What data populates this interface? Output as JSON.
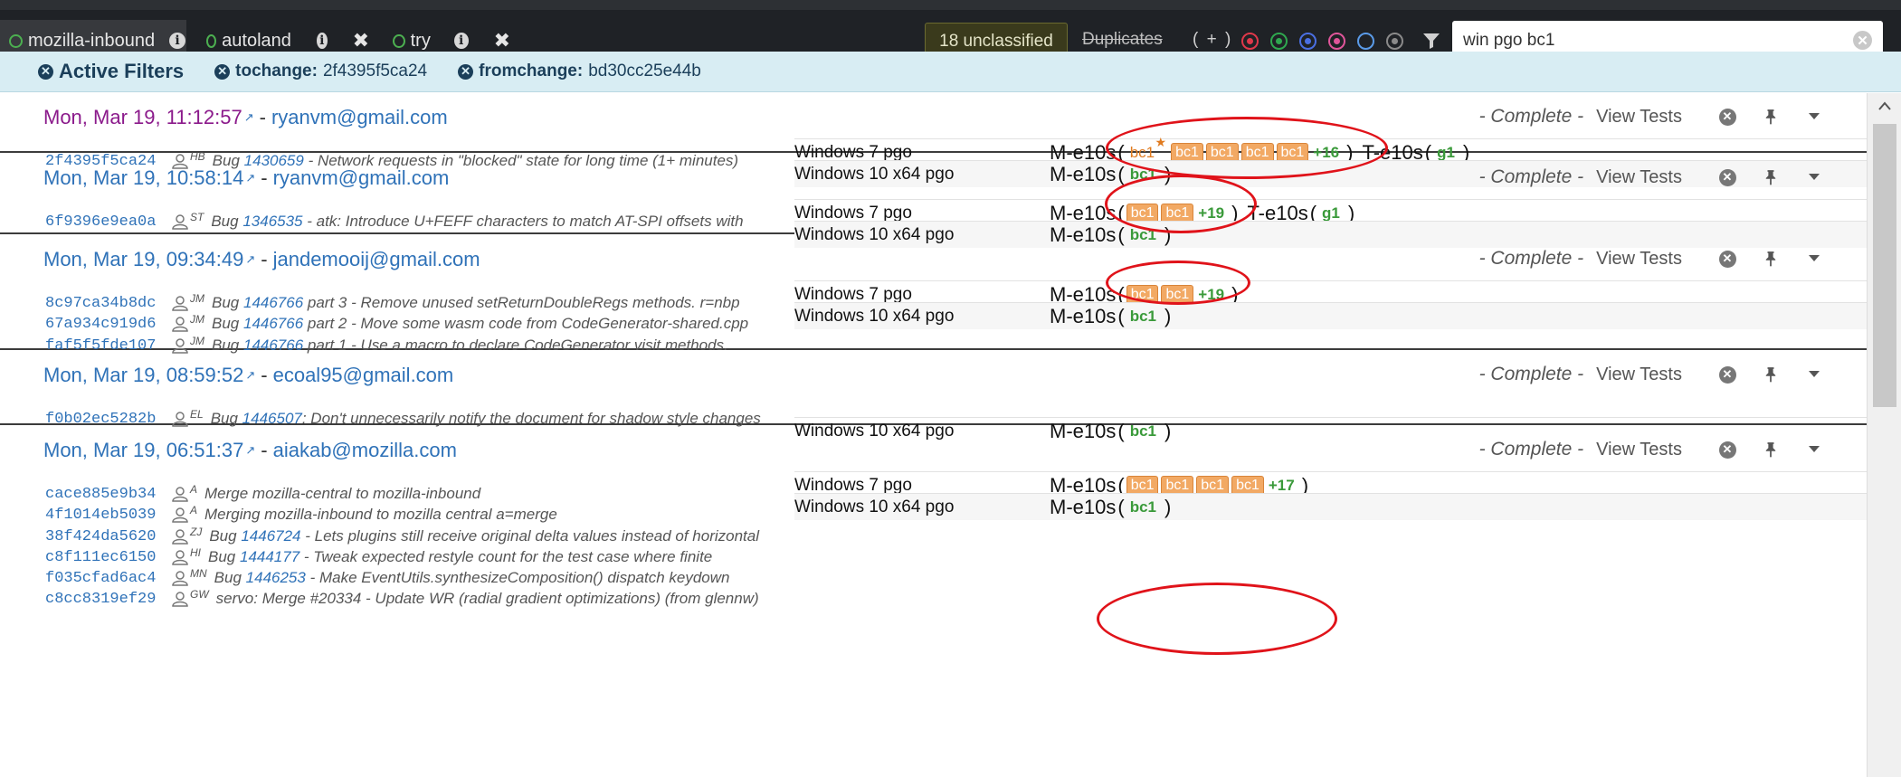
{
  "nav": {
    "repos": [
      {
        "name": "mozilla-inbound",
        "active": true
      },
      {
        "name": "autoland",
        "active": false
      },
      {
        "name": "try",
        "active": false
      }
    ],
    "unclassified_label": "18 unclassified",
    "duplicates_label": "Duplicates",
    "plus_label": "( + )",
    "status_colors": [
      "#e0384a",
      "#2fa84f",
      "#4a6fe3",
      "#e0559a",
      "#5a9be8",
      "#8a8a8a"
    ],
    "search": {
      "value": "win pgo bc1",
      "placeholder": ""
    }
  },
  "filters": {
    "title": "Active Filters",
    "chips": [
      {
        "key": "tochange:",
        "value": "2f4395f5ca24"
      },
      {
        "key": "fromchange:",
        "value": "bd30cc25e44b"
      }
    ]
  },
  "push_labels": {
    "complete": "- Complete -",
    "view_tests": "View Tests"
  },
  "pushes": [
    {
      "date": "Mon, Mar 19, 11:12:57",
      "author": "ryanvm@gmail.com",
      "unread": true,
      "revisions": [
        {
          "hash": "2f4395f5ca24",
          "initials": "HB",
          "bug_prefix": "Bug ",
          "bug": "1430659",
          "desc": " - Network requests in \"blocked\" state for long time (1+ minutes)"
        }
      ],
      "platforms": [
        {
          "name": "Windows 7 pgo",
          "group1": "M-e10s",
          "jobs": [
            "bc1",
            "bc1",
            "bc1",
            "bc1",
            "bc1"
          ],
          "first_starred": true,
          "more": "+16",
          "group2": "T-e10s",
          "group2_job": "g1"
        },
        {
          "name": "Windows 10 x64 pgo",
          "group1": "M-e10s",
          "green_job": "bc1"
        }
      ]
    },
    {
      "date": "Mon, Mar 19, 10:58:14",
      "author": "ryanvm@gmail.com",
      "unread": false,
      "revisions": [
        {
          "hash": "6f9396e9ea0a",
          "initials": "ST",
          "bug_prefix": "Bug ",
          "bug": "1346535",
          "desc": " - atk: Introduce U+FEFF characters to match AT-SPI offsets with"
        }
      ],
      "platforms": [
        {
          "name": "Windows 7 pgo",
          "group1": "M-e10s",
          "jobs": [
            "bc1",
            "bc1"
          ],
          "more": "+19",
          "group2": "T-e10s",
          "group2_job": "g1"
        },
        {
          "name": "Windows 10 x64 pgo",
          "group1": "M-e10s",
          "green_job": "bc1"
        }
      ]
    },
    {
      "date": "Mon, Mar 19, 09:34:49",
      "author": "jandemooij@gmail.com",
      "unread": false,
      "revisions": [
        {
          "hash": "8c97ca34b8dc",
          "initials": "JM",
          "bug_prefix": "Bug ",
          "bug": "1446766",
          "desc": " part 3 - Remove unused setReturnDoubleRegs methods. r=nbp"
        },
        {
          "hash": "67a934c919d6",
          "initials": "JM",
          "bug_prefix": "Bug ",
          "bug": "1446766",
          "desc": " part 2 - Move some wasm code from CodeGenerator-shared.cpp"
        },
        {
          "hash": "faf5f5fde107",
          "initials": "JM",
          "bug_prefix": "Bug ",
          "bug": "1446766",
          "desc": " part 1 - Use a macro to declare CodeGenerator visit methods."
        }
      ],
      "platforms": [
        {
          "name": "Windows 7 pgo",
          "group1": "M-e10s",
          "jobs": [
            "bc1",
            "bc1"
          ],
          "more": "+19"
        },
        {
          "name": "Windows 10 x64 pgo",
          "group1": "M-e10s",
          "green_job": "bc1"
        }
      ]
    },
    {
      "date": "Mon, Mar 19, 08:59:52",
      "author": "ecoal95@gmail.com",
      "unread": false,
      "revisions": [
        {
          "hash": "f0b02ec5282b",
          "initials": "EL",
          "bug_prefix": "Bug ",
          "bug": "1446507",
          "desc": ": Don't unnecessarily notify the document for shadow style changes"
        }
      ],
      "platforms": [
        {
          "name": "Windows 10 x64 pgo",
          "group1": "M-e10s",
          "green_job": "bc1"
        }
      ]
    },
    {
      "date": "Mon, Mar 19, 06:51:37",
      "author": "aiakab@mozilla.com",
      "unread": false,
      "revisions": [
        {
          "hash": "cace885e9b34",
          "initials": "A",
          "bug_prefix": "",
          "bug": "",
          "desc": "Merge mozilla-central to mozilla-inbound"
        },
        {
          "hash": "4f1014eb5039",
          "initials": "A",
          "bug_prefix": "",
          "bug": "",
          "desc": "Merging mozilla-inbound to mozilla central a=merge"
        },
        {
          "hash": "38f424da5620",
          "initials": "ZJ",
          "bug_prefix": "Bug ",
          "bug": "1446724",
          "desc": " - Lets plugins still receive original delta values instead of horizontal"
        },
        {
          "hash": "c8f111ec6150",
          "initials": "HI",
          "bug_prefix": "Bug ",
          "bug": "1444177",
          "desc": " - Tweak expected restyle count for the test case where finite"
        },
        {
          "hash": "f035cfad6ac4",
          "initials": "MN",
          "bug_prefix": "Bug ",
          "bug": "1446253",
          "desc": " - Make EventUtils.synthesizeComposition() dispatch keydown"
        },
        {
          "hash": "c8cc8319ef29",
          "initials": "GW",
          "bug_prefix": "",
          "bug": "",
          "desc": "servo: Merge #20334 - Update WR (radial gradient optimizations) (from glennw)"
        }
      ],
      "platforms": [
        {
          "name": "Windows 7 pgo",
          "group1": "M-e10s",
          "jobs": [
            "bc1",
            "bc1",
            "bc1",
            "bc1"
          ],
          "more": "+17"
        },
        {
          "name": "Windows 10 x64 pgo",
          "group1": "M-e10s",
          "green_job": "bc1"
        }
      ]
    }
  ]
}
